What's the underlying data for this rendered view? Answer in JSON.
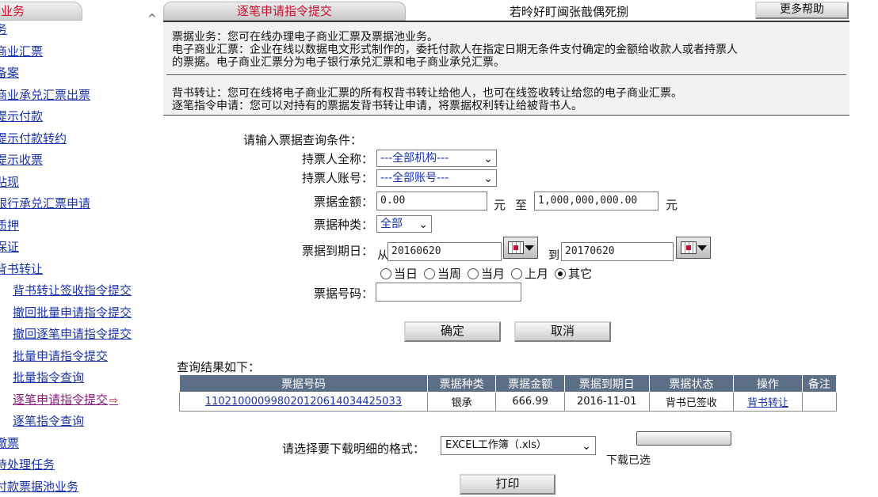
{
  "sidebar": {
    "tab": "业务",
    "items": [
      {
        "label": "务",
        "sub": false,
        "active": false
      },
      {
        "label": "商业汇票",
        "sub": false,
        "active": false
      },
      {
        "label": "备案",
        "sub": false,
        "active": false
      },
      {
        "label": "商业承兑汇票出票",
        "sub": false,
        "active": false
      },
      {
        "label": "提示付款",
        "sub": false,
        "active": false
      },
      {
        "label": "提示付款转约",
        "sub": false,
        "active": false
      },
      {
        "label": "提示收票",
        "sub": false,
        "active": false
      },
      {
        "label": "贴现",
        "sub": false,
        "active": false
      },
      {
        "label": "银行承兑汇票申请",
        "sub": false,
        "active": false
      },
      {
        "label": "质押",
        "sub": false,
        "active": false
      },
      {
        "label": "保证",
        "sub": false,
        "active": false
      },
      {
        "label": "背书转让",
        "sub": false,
        "active": false
      },
      {
        "label": "背书转让签收指令提交",
        "sub": true,
        "active": false
      },
      {
        "label": "撤回批量申请指令提交",
        "sub": true,
        "active": false
      },
      {
        "label": "撤回逐笔申请指令提交",
        "sub": true,
        "active": false
      },
      {
        "label": "批量申请指令提交",
        "sub": true,
        "active": false
      },
      {
        "label": "批量指令查询",
        "sub": true,
        "active": false
      },
      {
        "label": "逐笔申请指令提交",
        "sub": true,
        "active": true
      },
      {
        "label": "逐笔指令查询",
        "sub": true,
        "active": false
      },
      {
        "label": "撤票",
        "sub": false,
        "active": false
      },
      {
        "label": "待处理任务",
        "sub": false,
        "active": false
      },
      {
        "label": "付款票据池业务",
        "sub": false,
        "active": false
      }
    ]
  },
  "header": {
    "tab": "逐笔申请指令提交",
    "text": "若昤好盯闽张戠偶死捌",
    "more_help": "更多帮助"
  },
  "info": {
    "line1": "票据业务：您可在线办理电子商业汇票及票据池业务。",
    "line2": "电子商业汇票：企业在线以数据电文形式制作的，委托付款人在指定日期无条件支付确定的金额给收款人或者持票人",
    "line3": "的票据。电子商业汇票分为电子银行承兑汇票和电子商业承兑汇票。",
    "line4": "背书转让：您可在线将电子商业汇票的所有权背书转让给他人，也可在线签收转让给您的电子商业汇票。",
    "line5": "逐笔指令申请：您可以对持有的票据发背书转让申请，将票据权利转让给被背书人。"
  },
  "form": {
    "title": "请输入票据查询条件：",
    "holder_name_label": "持票人全称：",
    "holder_name_value": "---全部机构---",
    "holder_account_label": "持票人账号：",
    "holder_account_value": "---全部账号---",
    "amount_label": "票据金额：",
    "amount_from": "0.00",
    "amount_unit": "元",
    "amount_to_word": "至",
    "amount_to": "1,000,000,000.00",
    "type_label": "票据种类：",
    "type_value": "全部",
    "due_label": "票据到期日：",
    "date_from_word": "从",
    "date_from": "20160620",
    "date_to_word": "到",
    "date_to": "20170620",
    "radios": [
      "当日",
      "当周",
      "当月",
      "上月",
      "其它"
    ],
    "bill_no_label": "票据号码：",
    "bill_no_value": "",
    "confirm": "确定",
    "cancel": "取消"
  },
  "results": {
    "title": "查询结果如下：",
    "columns": [
      "票据号码",
      "票据种类",
      "票据金额",
      "票据到期日",
      "票据状态",
      "操作",
      "备注"
    ],
    "rows": [
      [
        "110210000998020120614034425033",
        "银承",
        "666.99",
        "2016-11-01",
        "背书已签收",
        "背书转让",
        ""
      ]
    ]
  },
  "bottom": {
    "format_label": "请选择要下载明细的格式：",
    "format_value": "EXCEL工作簿（.xls）",
    "download_label": "下载已选",
    "print": "打印"
  },
  "colors": {
    "tab_text": "#c8102e",
    "link": "#1a33a8",
    "table_header": "#5d6f86"
  }
}
